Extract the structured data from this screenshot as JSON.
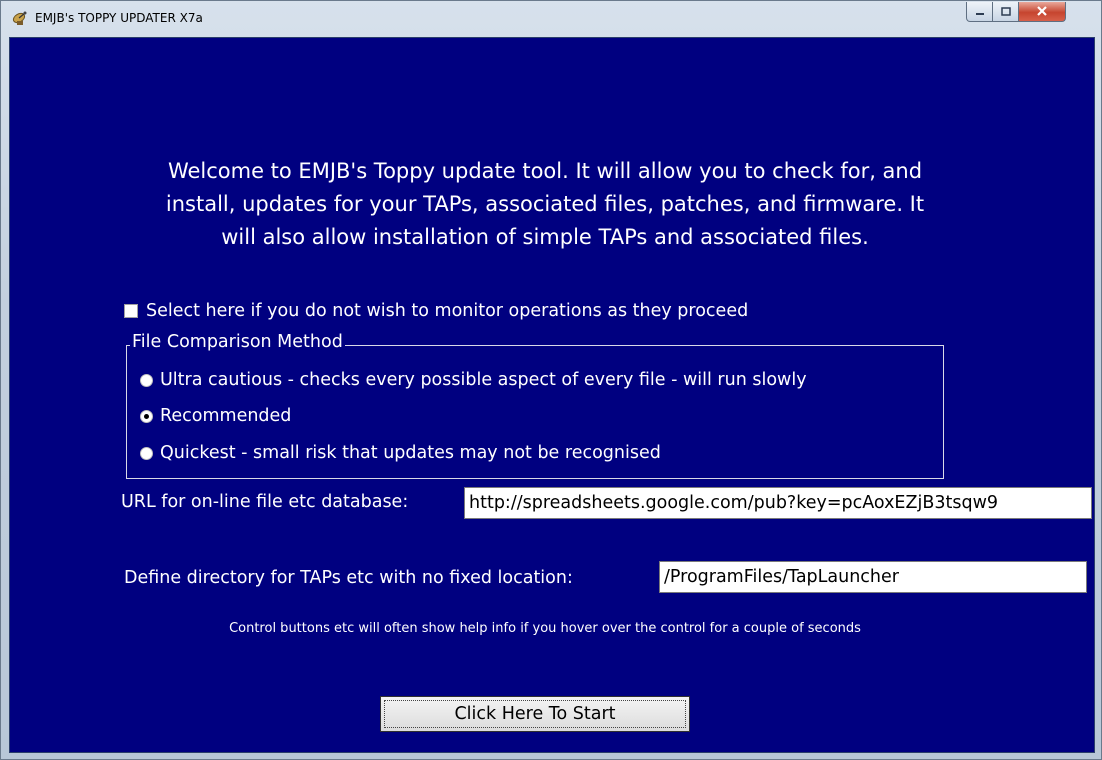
{
  "window": {
    "title": "EMJB's TOPPY UPDATER X7a",
    "icon": "satellite-dish-icon"
  },
  "welcome": {
    "line1": "Welcome to EMJB's Toppy update tool. It will allow you to check for, and",
    "line2": "install, updates for your TAPs, associated files, patches, and firmware. It",
    "line3": "will also allow installation of simple TAPs and associated files."
  },
  "monitor_checkbox": {
    "label": "Select here if you do not wish to monitor operations as they proceed",
    "checked": false
  },
  "comparison": {
    "title": "File Comparison Method",
    "options": [
      {
        "label": "Ultra cautious - checks every possible aspect of every file - will run slowly",
        "selected": false
      },
      {
        "label": "Recommended",
        "selected": true
      },
      {
        "label": "Quickest - small risk that updates may not be recognised",
        "selected": false
      }
    ]
  },
  "url": {
    "label": "URL for on-line file etc database:",
    "value": "http://spreadsheets.google.com/pub?key=pcAoxEZjB3tsqw9"
  },
  "directory": {
    "label": "Define directory for TAPs etc with no fixed location:",
    "value": "/ProgramFiles/TapLauncher"
  },
  "hint": "Control buttons etc will often show help info if you hover over the control for a couple of seconds",
  "start_button": "Click Here To Start",
  "colors": {
    "client_background": "#000080",
    "text": "#ffffff",
    "close_button": "#c6452f"
  }
}
